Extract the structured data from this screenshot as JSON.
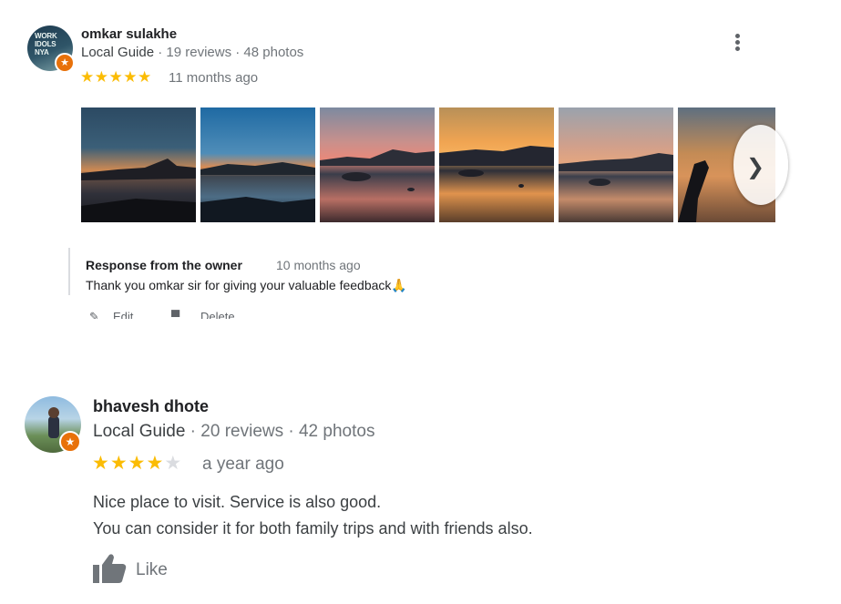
{
  "reviews": [
    {
      "name": "omkar sulakhe",
      "guide_label": "Local Guide",
      "stats": " · 19 reviews · 48 photos",
      "rating": 5,
      "stars_text": "★★★★★",
      "time": "11 months ago",
      "avatar_logo_text": "WORK IDOLS NYA",
      "owner_response": {
        "heading": "Response from the owner",
        "time": "10 months ago",
        "text": "Thank you omkar sir for giving your valuable feedback🙏"
      },
      "actions": {
        "edit": "Edit",
        "delete": "Delete"
      }
    },
    {
      "name": "bhavesh dhote",
      "guide_label": "Local Guide",
      "stats": " · 20 reviews · 42 photos",
      "rating": 4,
      "stars_filled": "★★★★",
      "stars_empty": "★",
      "time": "a year ago",
      "text_line1": "Nice place to visit. Service is also good.",
      "text_line2": "You can consider it for both family trips and with friends also.",
      "like_label": "Like"
    }
  ],
  "icons": {
    "more": "more-vert-icon",
    "next": "chevron-right-icon",
    "badge": "local-guide-star-icon",
    "like": "thumb-up-icon",
    "edit": "pencil-icon",
    "delete": "trash-icon"
  },
  "colors": {
    "star": "#fbbc04",
    "guide_badge": "#e8710a",
    "secondary_text": "#70757a"
  }
}
